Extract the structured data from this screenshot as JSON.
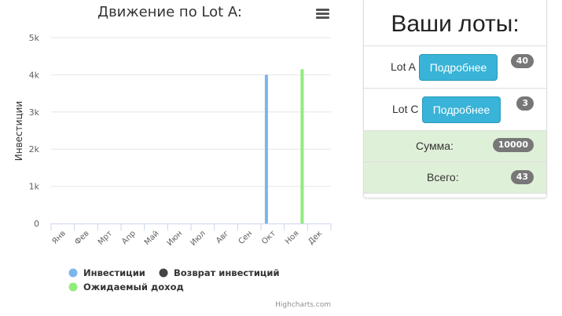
{
  "chart_data": {
    "type": "bar",
    "title": "Движение по Lot A:",
    "ylabel": "Инвестиции",
    "xlabel": "",
    "categories": [
      "Янв",
      "Фев",
      "Мрт",
      "Апр",
      "Май",
      "Июн",
      "Июл",
      "Авг",
      "Сен",
      "Окт",
      "Ноя",
      "Дек"
    ],
    "ylim": [
      0,
      5000
    ],
    "yticks": [
      "0",
      "1k",
      "2k",
      "3k",
      "4k",
      "5k"
    ],
    "series": [
      {
        "name": "Инвестиции",
        "color": "#7cb5ec",
        "values": [
          0,
          0,
          0,
          0,
          0,
          0,
          0,
          0,
          0,
          4000,
          0,
          0
        ]
      },
      {
        "name": "Возврат инвестиций",
        "color": "#434348",
        "values": [
          0,
          0,
          0,
          0,
          0,
          0,
          0,
          0,
          0,
          0,
          0,
          0
        ]
      },
      {
        "name": "Ожидаемый доход",
        "color": "#90ed7d",
        "values": [
          0,
          0,
          0,
          0,
          0,
          0,
          0,
          0,
          0,
          0,
          4150,
          0
        ]
      }
    ],
    "grid": true,
    "legend_position": "bottom-left",
    "credits": "Highcharts.com"
  },
  "panel": {
    "title": "Ваши лоты:",
    "lots": [
      {
        "name": "Lot A",
        "button": "Подробнее",
        "count": "40"
      },
      {
        "name": "Lot C",
        "button": "Подробнее",
        "count": "3"
      }
    ],
    "sum_label": "Сумма:",
    "sum_value": "10000",
    "total_label": "Всего:",
    "total_value": "43"
  },
  "icons": {
    "menu": "hamburger-menu-icon",
    "legend_marker": "circle"
  }
}
